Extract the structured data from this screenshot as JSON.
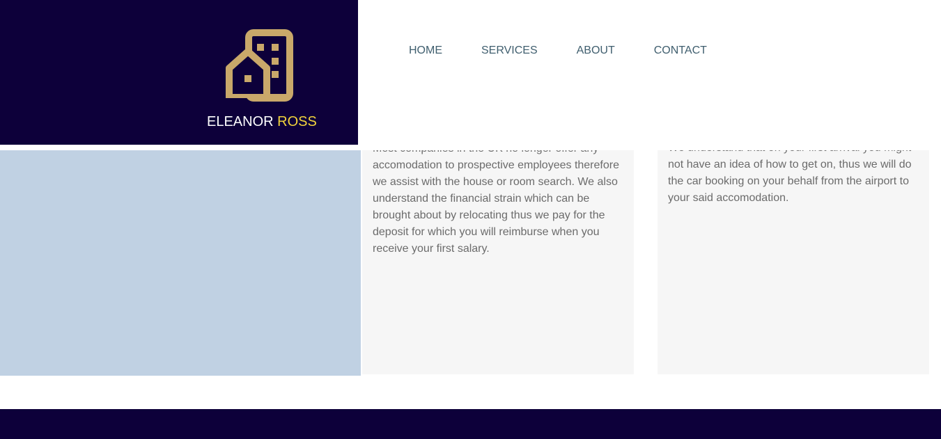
{
  "brand": {
    "first": "ELEANOR",
    "last": "ROSS",
    "logo_icon": "building-house-icon",
    "colors": {
      "header_bg": "#0d003a",
      "logo_gold": "#c9a86a",
      "accent_yellow": "#f2d33c"
    }
  },
  "nav": {
    "items": [
      {
        "label": "HOME"
      },
      {
        "label": "SERVICES"
      },
      {
        "label": "ABOUT"
      },
      {
        "label": "CONTACT"
      }
    ]
  },
  "cards": [
    {
      "text": "Most companies in the UK no longer offer any accomodation to prospective employees therefore we assist with the house or room search. We also understand the financial strain which can be brought about by relocating thus we pay for the deposit for which you will reimburse when you receive your first salary."
    },
    {
      "text": "We understand that on your first arrival you might not have an idea of how to get on, thus we will do the car booking on your behalf from the airport to your said accomodation."
    }
  ]
}
